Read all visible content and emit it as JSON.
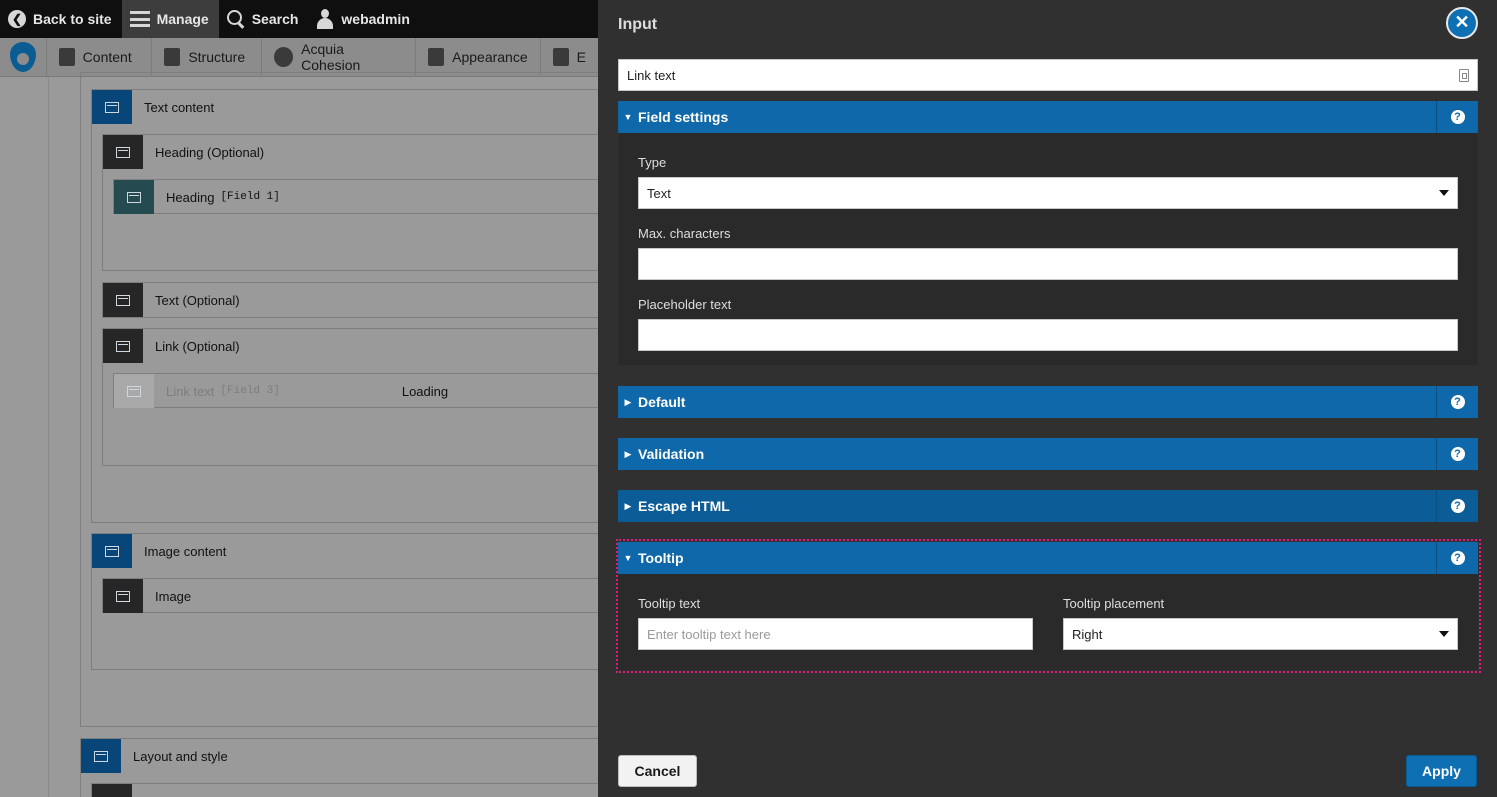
{
  "toolbar": {
    "back_label": "Back to site",
    "manage_label": "Manage",
    "search_label": "Search",
    "user_label": "webadmin"
  },
  "subbar": {
    "items": [
      "Content",
      "Structure",
      "Acquia Cohesion",
      "Appearance",
      "E"
    ]
  },
  "canvas": {
    "text_content": "Text content",
    "heading_optional": "Heading (Optional)",
    "heading_field": "Heading",
    "heading_field_tag": "[Field 1]",
    "text_optional": "Text (Optional)",
    "link_optional": "Link (Optional)",
    "link_text_field": "Link text",
    "link_text_tag": "[Field 3]",
    "loading": "Loading",
    "image_content": "Image content",
    "image": "Image",
    "layout_style": "Layout and style"
  },
  "panel": {
    "title": "Input",
    "close_symbol": "✕",
    "name_value": "Link text",
    "field_settings": {
      "title": "Field settings",
      "type_label": "Type",
      "type_value": "Text",
      "max_label": "Max. characters",
      "max_value": "",
      "placeholder_label": "Placeholder text",
      "placeholder_value": ""
    },
    "sections": {
      "default": "Default",
      "validation": "Validation",
      "escape_html": "Escape HTML",
      "tooltip": "Tooltip"
    },
    "tooltip": {
      "text_label": "Tooltip text",
      "text_placeholder": "Enter tooltip text here",
      "placement_label": "Tooltip placement",
      "placement_value": "Right"
    },
    "help_symbol": "?",
    "cancel_label": "Cancel",
    "apply_label": "Apply"
  },
  "colors": {
    "accent_blue": "#0e68a9",
    "panel_bg": "#303030",
    "focus_outline": "#e0177f"
  }
}
